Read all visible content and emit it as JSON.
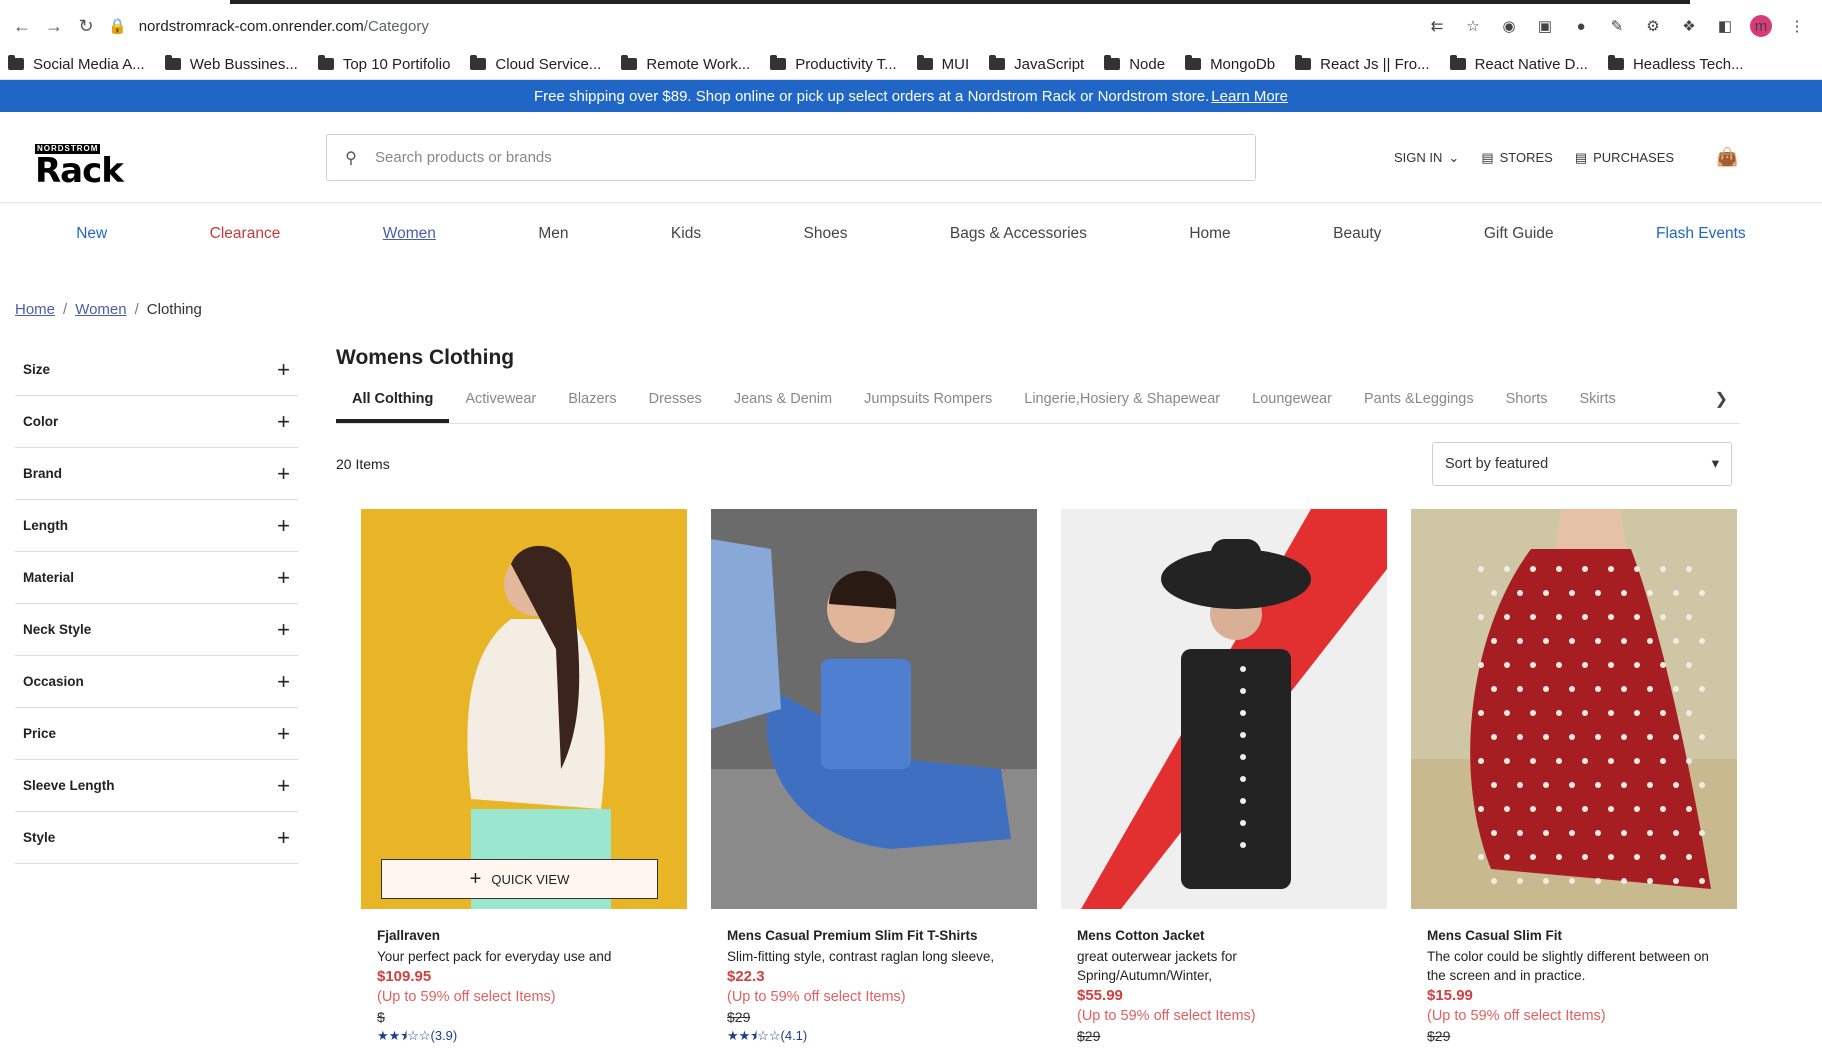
{
  "browser": {
    "url_domain": "nordstromrack-com.onrender.com",
    "url_path": "/Category",
    "avatar_letter": "m",
    "bookmarks": [
      "Social Media A...",
      "Web Bussines...",
      "Top 10 Portifolio",
      "Cloud Service...",
      "Remote Work...",
      "Productivity T...",
      "MUI",
      "JavaScript",
      "Node",
      "MongoDb",
      "React Js || Fro...",
      "React Native D...",
      "Headless Tech..."
    ]
  },
  "banner": {
    "text": "Free shipping over $89. Shop online or pick up select orders at a Nordstrom Rack or Nordstrom store.",
    "link": "Learn More"
  },
  "header": {
    "logo_small": "NORDSTROM",
    "logo_big": "Rack",
    "search_placeholder": "Search products or brands",
    "sign_in": "SIGN IN",
    "stores": "STORES",
    "purchases": "PURCHASES"
  },
  "nav": [
    "New",
    "Clearance",
    "Women",
    "Men",
    "Kids",
    "Shoes",
    "Bags & Accessories",
    "Home",
    "Beauty",
    "Gift Guide",
    "Flash Events"
  ],
  "breadcrumb": {
    "home": "Home",
    "women": "Women",
    "current": "Clothing"
  },
  "filters": [
    "Size",
    "Color",
    "Brand",
    "Length",
    "Material",
    "Neck Style",
    "Occasion",
    "Price",
    "Sleeve Length",
    "Style"
  ],
  "page": {
    "title": "Womens Clothing",
    "tabs": [
      "All Colthing",
      "Activewear",
      "Blazers",
      "Dresses",
      "Jeans & Denim",
      "Jumpsuits Rompers",
      "Lingerie,Hosiery & Shapewear",
      "Loungewear",
      "Pants &Leggings",
      "Shorts",
      "Skirts"
    ],
    "count": "20 Items",
    "sort": "Sort by featured",
    "quick_view": "QUICK VIEW"
  },
  "products": [
    {
      "name": "Fjallraven",
      "desc": "Your perfect pack for everyday use and",
      "price": "$109.95",
      "off": "(Up to 59% off select Items)",
      "orig": "$",
      "rating": "(3.9)",
      "stars": 2.5,
      "colors": {
        "bg": "#e8b526",
        "fig": "#f3ede3",
        "accent": "#9ae6cf"
      }
    },
    {
      "name": "Mens Casual Premium Slim Fit T-Shirts",
      "desc": "Slim-fitting style, contrast raglan long sleeve,",
      "price": "$22.3",
      "off": "(Up to 59% off select Items)",
      "orig": "$29",
      "rating": "(4.1)",
      "stars": 2.5,
      "colors": {
        "bg": "#6b6b6b",
        "fig": "#4f7fd0",
        "accent": "#e1b59a"
      }
    },
    {
      "name": "Mens Cotton Jacket",
      "desc": "great outerwear jackets for Spring/Autumn/Winter,",
      "price": "$55.99",
      "off": "(Up to 59% off select Items)",
      "orig": "$29",
      "rating": "",
      "stars": 0,
      "colors": {
        "bg": "#efefef",
        "fig": "#232323",
        "accent": "#e23030"
      }
    },
    {
      "name": "Mens Casual Slim Fit",
      "desc": "The color could be slightly different between on the screen and in practice.",
      "price": "$15.99",
      "off": "(Up to 59% off select Items)",
      "orig": "$29",
      "rating": "",
      "stars": 0,
      "colors": {
        "bg": "#cfc6a6",
        "fig": "#a71e22",
        "accent": "#f0ece4"
      }
    }
  ]
}
